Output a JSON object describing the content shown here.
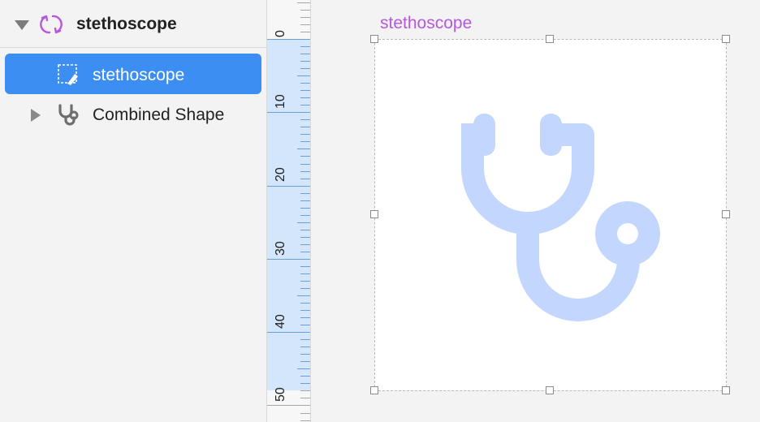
{
  "layers": {
    "root": {
      "label": "stethoscope",
      "icon": "symbol-sync-icon"
    },
    "items": [
      {
        "label": "stethoscope",
        "icon": "artboard-icon",
        "selected": true
      },
      {
        "label": "Combined Shape",
        "icon": "stethoscope-icon",
        "selected": false
      }
    ]
  },
  "ruler": {
    "labels": [
      "0",
      "10",
      "20",
      "30",
      "40",
      "50"
    ]
  },
  "canvas": {
    "artboard_title": "stethoscope",
    "artboard_icon": "stethoscope-icon"
  },
  "colors": {
    "selection": "#3c8ef3",
    "symbol": "#b657e0",
    "ruler_highlight": "#d3e6fb",
    "icon_fill": "#c3d6fd"
  }
}
